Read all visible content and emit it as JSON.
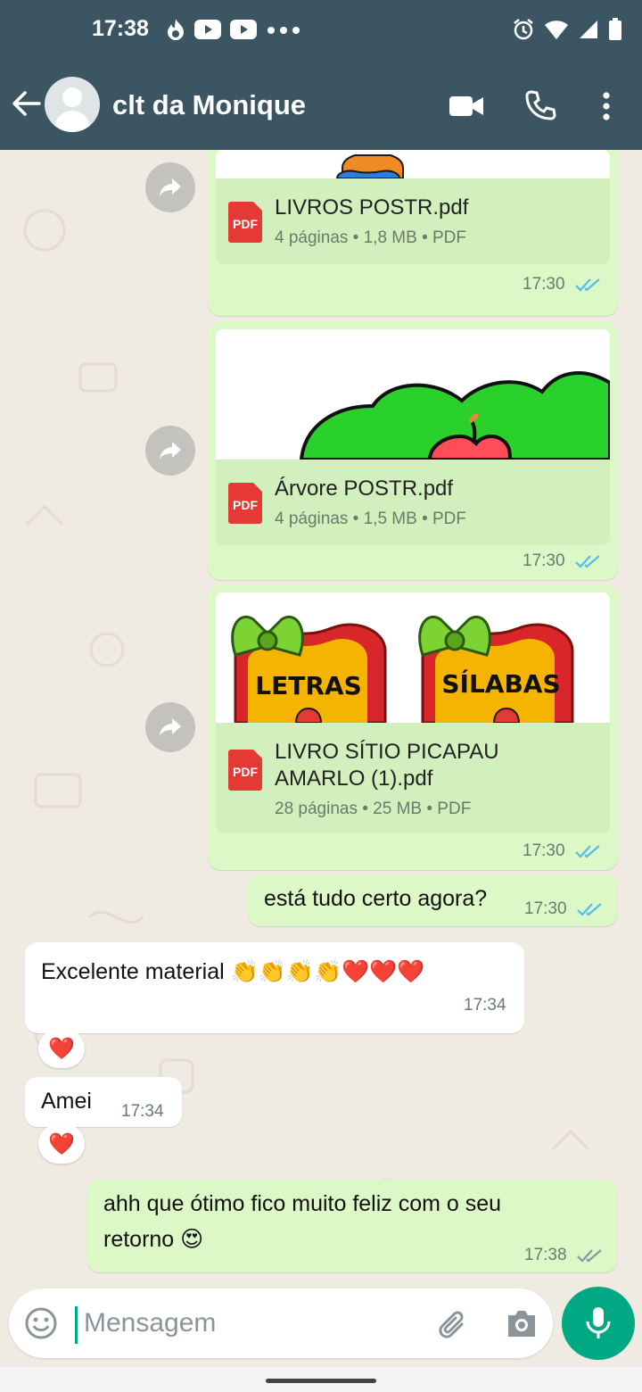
{
  "status_bar": {
    "time": "17:38"
  },
  "header": {
    "contact_name": "clt da Monique"
  },
  "messages": [
    {
      "file_name": "LIVROS POSTR.pdf",
      "meta": "4 páginas • 1,8 MB • PDF",
      "time": "17:30"
    },
    {
      "file_name": "Árvore POSTR.pdf",
      "meta": "4 páginas • 1,5 MB • PDF",
      "time": "17:30"
    },
    {
      "file_name_line1": "LIVRO SÍTIO PICAPAU",
      "file_name_line2": "AMARLO (1).pdf",
      "meta": "28 páginas • 25 MB • PDF",
      "time": "17:30",
      "preview_labels": [
        "LETRAS",
        "SÍLABAS"
      ]
    },
    {
      "text": "está tudo certo agora?",
      "time": "17:30"
    },
    {
      "text": "Excelente material 👏👏👏👏❤️❤️❤️",
      "time": "17:34",
      "reaction": "❤️"
    },
    {
      "text": "Amei",
      "time": "17:34",
      "reaction": "❤️"
    },
    {
      "text_line1": "ahh que ótimo fico muito feliz com o seu",
      "text_line2": "retorno 😍",
      "time": "17:38"
    }
  ],
  "input": {
    "placeholder": "Mensagem"
  },
  "colors": {
    "header": "#3b5563",
    "outgoing": "#dcf8c6",
    "accent": "#00a884",
    "read_ticks": "#53bdeb"
  }
}
